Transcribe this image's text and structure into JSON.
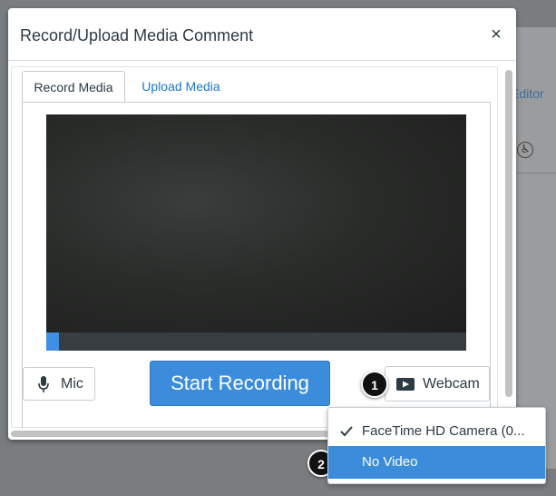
{
  "modal": {
    "title": "Record/Upload Media Comment",
    "close_label": "×"
  },
  "tabs": [
    {
      "label": "Record Media",
      "active": true
    },
    {
      "label": "Upload Media",
      "active": false
    }
  ],
  "background": {
    "editor_link": "Editor"
  },
  "controls": {
    "mic_label": "Mic",
    "start_label": "Start Recording",
    "webcam_label": "Webcam"
  },
  "dropdown": {
    "items": [
      {
        "label": "FaceTime HD Camera (0...",
        "checked": true
      },
      {
        "label": "No Video",
        "checked": false,
        "highlighted": true
      }
    ]
  },
  "callouts": [
    "1",
    "2"
  ],
  "colors": {
    "accent": "#3b8ddb",
    "link": "#1f76c7",
    "text": "#2d3b45"
  }
}
